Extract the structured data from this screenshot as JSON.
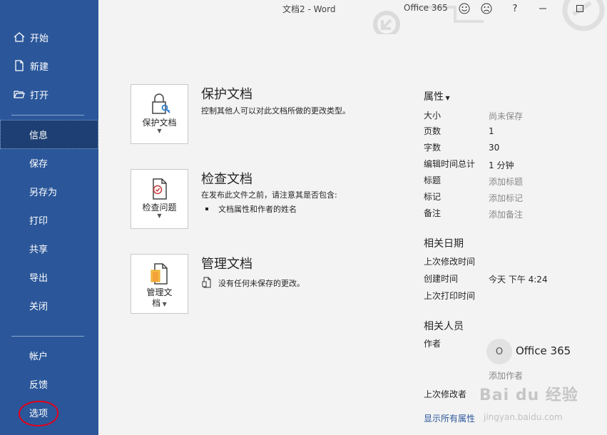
{
  "window": {
    "doc_title": "文档2  -  Word",
    "account": "Office 365",
    "help": "?"
  },
  "sidebar": {
    "home": "开始",
    "new": "新建",
    "open": "打开",
    "info": "信息",
    "save": "保存",
    "save_as": "另存为",
    "print": "打印",
    "share": "共享",
    "export": "导出",
    "close": "关闭",
    "account": "帐户",
    "feedback": "反馈",
    "options": "选项"
  },
  "protect": {
    "card_label": "保护文档",
    "title": "保护文档",
    "desc": "控制其他人可以对此文档所做的更改类型。"
  },
  "inspect": {
    "card_label": "检查问题",
    "title": "检查文档",
    "desc": "在发布此文件之前，请注意其是否包含:",
    "bullet": "文档属性和作者的姓名"
  },
  "manage": {
    "card_label_1": "管理文",
    "card_label_2": "档",
    "title": "管理文档",
    "desc": "没有任何未保存的更改。"
  },
  "properties": {
    "heading": "属性",
    "size_label": "大小",
    "size_value": "尚未保存",
    "pages_label": "页数",
    "pages_value": "1",
    "words_label": "字数",
    "words_value": "30",
    "edit_time_label": "编辑时间总计",
    "edit_time_value": "1 分钟",
    "title_label": "标题",
    "title_value": "添加标题",
    "tags_label": "标记",
    "tags_value": "添加标记",
    "comments_label": "备注",
    "comments_value": "添加备注"
  },
  "dates": {
    "heading": "相关日期",
    "modified_label": "上次修改时间",
    "created_label": "创建时间",
    "created_value": "今天 下午 4:24",
    "printed_label": "上次打印时间"
  },
  "people": {
    "heading": "相关人员",
    "author_label": "作者",
    "author_initial": "O",
    "author_name": "Office 365",
    "add_author": "添加作者",
    "last_modified_by_label": "上次修改者"
  },
  "show_all": "显示所有属性",
  "watermark": {
    "text": "Bai du 经验",
    "url": "jingyan.baidu.com"
  },
  "colors": {
    "sidebar": "#2b579a",
    "active": "#1e3f73",
    "annotation": "#e3001b"
  }
}
